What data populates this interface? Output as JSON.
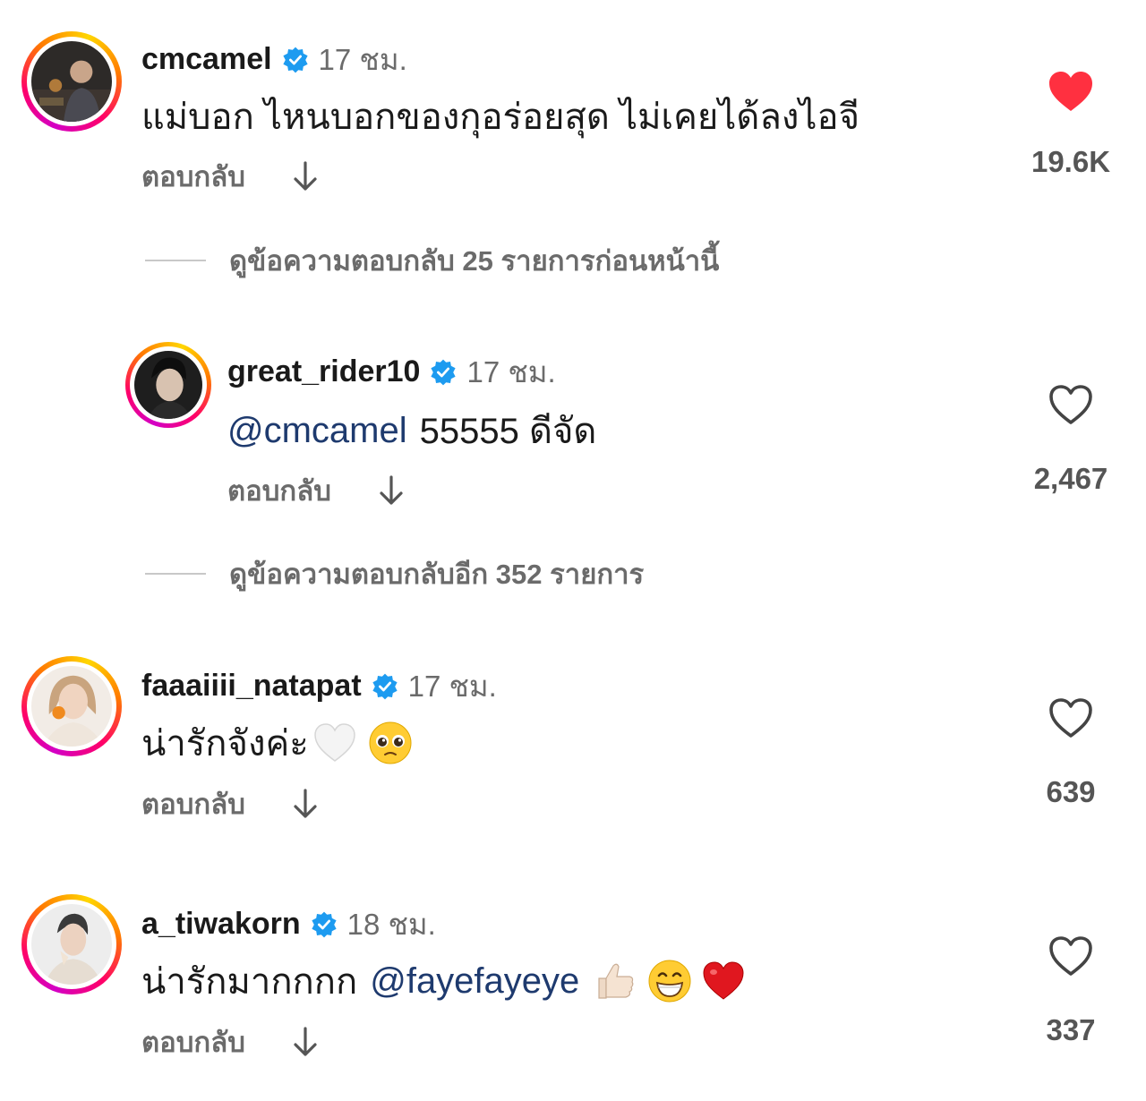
{
  "comments": [
    {
      "username": "cmcamel",
      "time": "17 ชม.",
      "text": "แม่บอก ไหนบอกของกุอร่อยสุด ไม่เคยได้ลงไอจี",
      "reply_label": "ตอบกลับ",
      "likes": "19.6K",
      "liked": true
    },
    {
      "username": "great_rider10",
      "time": "17 ชม.",
      "mention": "@cmcamel",
      "text": "55555 ดีจัด",
      "reply_label": "ตอบกลับ",
      "likes": "2,467",
      "liked": false
    },
    {
      "username": "faaaiiii_natapat",
      "time": "17 ชม.",
      "text": "น่ารักจังค่ะ",
      "emojis": [
        "white-heart-icon",
        "pleading-face-icon"
      ],
      "reply_label": "ตอบกลับ",
      "likes": "639",
      "liked": false
    },
    {
      "username": "a_tiwakorn",
      "time": "18 ชม.",
      "text": "น่ารักมากกกก",
      "mention": "@fayefayeye",
      "emojis": [
        "thumbs-up-icon",
        "grinning-face-icon",
        "red-heart-icon"
      ],
      "reply_label": "ตอบกลับ",
      "likes": "337",
      "liked": false
    }
  ],
  "view_previous_replies": "ดูข้อความตอบกลับ 25 รายการก่อนหน้านี้",
  "view_more_replies": "ดูข้อความตอบกลับอีก 352 รายการ",
  "colors": {
    "verified": "#1d9bf0",
    "liked_heart": "#ff3040",
    "mention": "#1e3a6e",
    "secondary_text": "#6b6b6b"
  }
}
